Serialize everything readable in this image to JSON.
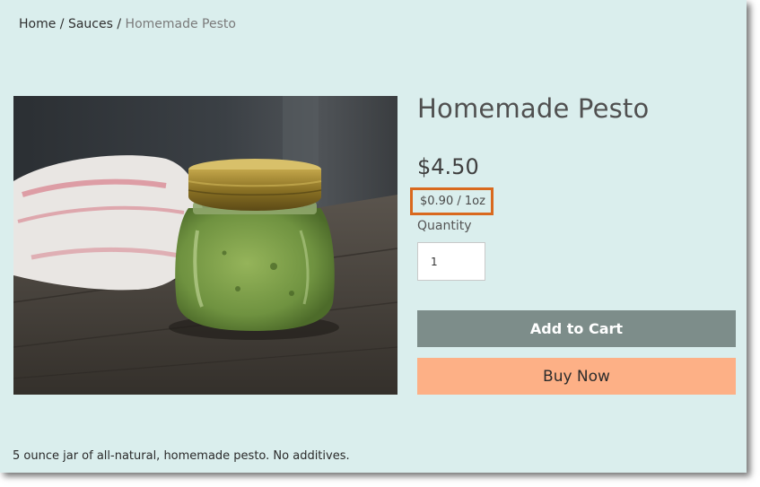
{
  "breadcrumb": {
    "home": "Home",
    "sep1": "/",
    "category": "Sauces",
    "sep2": "/",
    "current": "Homemade Pesto"
  },
  "product": {
    "title": "Homemade Pesto",
    "price": "$4.50",
    "unit_price": "$0.90 / 1oz",
    "quantity_label": "Quantity",
    "quantity_value": "1",
    "description": "5 ounce jar of all-natural, homemade pesto. No additives."
  },
  "actions": {
    "add_to_cart": "Add to Cart",
    "buy_now": "Buy Now"
  },
  "colors": {
    "page_background": "#daeeed",
    "add_to_cart_bg": "#7d8d8a",
    "buy_now_bg": "#fdb086",
    "highlight_border": "#d9691e"
  }
}
